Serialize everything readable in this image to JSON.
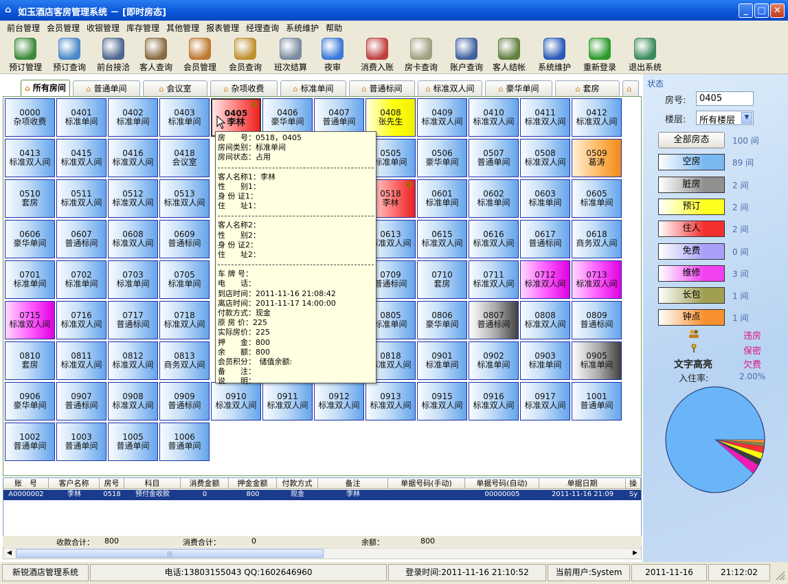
{
  "window": {
    "title": "如玉酒店客房管理系统 － [即时房态]",
    "icon": "app-house-icon"
  },
  "menu": [
    "前台管理",
    "会员管理",
    "收银管理",
    "库存管理",
    "其他管理",
    "报表管理",
    "经理查询",
    "系统维护",
    "帮助"
  ],
  "toolbar": [
    {
      "label": "预订管理",
      "icon": "globe-icon"
    },
    {
      "label": "预订查询",
      "icon": "magnifier-doc-icon"
    },
    {
      "label": "前台接洽",
      "icon": "receptionist-icon"
    },
    {
      "label": "客人查询",
      "icon": "person-search-icon"
    },
    {
      "label": "会员管理",
      "icon": "members-icon"
    },
    {
      "label": "会员查询",
      "icon": "member-key-icon"
    },
    {
      "label": "班次结算",
      "icon": "printer-icon"
    },
    {
      "label": "夜审",
      "icon": "clock-icon"
    },
    {
      "label": "消费入账",
      "icon": "house-entry-icon"
    },
    {
      "label": "房卡查询",
      "icon": "card-icon"
    },
    {
      "label": "账户查询",
      "icon": "monitor-icon"
    },
    {
      "label": "客人结帐",
      "icon": "checkout-chart-icon"
    },
    {
      "label": "系统维护",
      "icon": "tools-icon"
    },
    {
      "label": "重新登录",
      "icon": "refresh-icon"
    },
    {
      "label": "退出系统",
      "icon": "exit-door-icon"
    }
  ],
  "tabs": [
    "所有房间",
    "普通单间",
    "会议室",
    "杂项收费",
    "标准单间",
    "普通标间",
    "标准双人间",
    "豪华单间",
    "套房",
    ""
  ],
  "rooms": [
    {
      "n": "0000",
      "t": "杂项收费",
      "s": ""
    },
    {
      "n": "0401",
      "t": "标准单间",
      "s": ""
    },
    {
      "n": "0402",
      "t": "标准单间",
      "s": ""
    },
    {
      "n": "0403",
      "t": "标准单间",
      "s": ""
    },
    {
      "n": "0405",
      "t": "李林",
      "s": "red",
      "sel": true,
      "p": true
    },
    {
      "n": "0406",
      "t": "豪华单间",
      "s": ""
    },
    {
      "n": "0407",
      "t": "普通单间",
      "s": ""
    },
    {
      "n": "0408",
      "t": "张先生",
      "s": "yellow"
    },
    {
      "n": "0409",
      "t": "标准双人间",
      "s": ""
    },
    {
      "n": "0410",
      "t": "标准双人间",
      "s": ""
    },
    {
      "n": "0411",
      "t": "标准双人间",
      "s": ""
    },
    {
      "n": "0412",
      "t": "标准双人间",
      "s": ""
    },
    {
      "n": "0413",
      "t": "标准双人间",
      "s": ""
    },
    {
      "n": "0415",
      "t": "标准双人间",
      "s": ""
    },
    {
      "n": "0416",
      "t": "标准双人间",
      "s": ""
    },
    {
      "n": "0418",
      "t": "会议室",
      "s": ""
    },
    {
      "n": "",
      "t": "",
      "s": "",
      "hid": true
    },
    {
      "n": "",
      "t": "",
      "s": "",
      "hid": true
    },
    {
      "n": "",
      "t": "",
      "s": "",
      "hid": true
    },
    {
      "n": "0505",
      "t": "标准单间",
      "s": ""
    },
    {
      "n": "0506",
      "t": "豪华单间",
      "s": ""
    },
    {
      "n": "0507",
      "t": "普通单间",
      "s": ""
    },
    {
      "n": "0508",
      "t": "标准双人间",
      "s": ""
    },
    {
      "n": "0509",
      "t": "葛涛",
      "s": "orange"
    },
    {
      "n": "0510",
      "t": "套房",
      "s": ""
    },
    {
      "n": "0511",
      "t": "标准双人间",
      "s": ""
    },
    {
      "n": "0512",
      "t": "标准双人间",
      "s": ""
    },
    {
      "n": "0513",
      "t": "标准双人间",
      "s": ""
    },
    {
      "n": "",
      "t": "",
      "s": "",
      "hid": true
    },
    {
      "n": "",
      "t": "",
      "s": "",
      "hid": true
    },
    {
      "n": "",
      "t": "",
      "s": "",
      "hid": true
    },
    {
      "n": "0518",
      "t": "李林",
      "s": "red",
      "p": true
    },
    {
      "n": "0601",
      "t": "标准单间",
      "s": ""
    },
    {
      "n": "0602",
      "t": "标准单间",
      "s": ""
    },
    {
      "n": "0603",
      "t": "标准单间",
      "s": ""
    },
    {
      "n": "0605",
      "t": "标准单间",
      "s": ""
    },
    {
      "n": "0606",
      "t": "豪华单间",
      "s": ""
    },
    {
      "n": "0607",
      "t": "普通标间",
      "s": ""
    },
    {
      "n": "0608",
      "t": "标准双人间",
      "s": ""
    },
    {
      "n": "0609",
      "t": "普通标间",
      "s": ""
    },
    {
      "n": "",
      "t": "",
      "s": "",
      "hid": true
    },
    {
      "n": "",
      "t": "",
      "s": "",
      "hid": true
    },
    {
      "n": "",
      "t": "",
      "s": "",
      "hid": true
    },
    {
      "n": "0613",
      "t": "标准双人间",
      "s": ""
    },
    {
      "n": "0615",
      "t": "标准双人间",
      "s": ""
    },
    {
      "n": "0616",
      "t": "标准双人间",
      "s": ""
    },
    {
      "n": "0617",
      "t": "普通标间",
      "s": ""
    },
    {
      "n": "0618",
      "t": "商务双人间",
      "s": ""
    },
    {
      "n": "0701",
      "t": "标准单间",
      "s": ""
    },
    {
      "n": "0702",
      "t": "标准单间",
      "s": ""
    },
    {
      "n": "0703",
      "t": "标准单间",
      "s": ""
    },
    {
      "n": "0705",
      "t": "标准单间",
      "s": ""
    },
    {
      "n": "",
      "t": "",
      "s": "",
      "hid": true
    },
    {
      "n": "",
      "t": "",
      "s": "",
      "hid": true
    },
    {
      "n": "",
      "t": "",
      "s": "",
      "hid": true
    },
    {
      "n": "0709",
      "t": "普通标间",
      "s": ""
    },
    {
      "n": "0710",
      "t": "套房",
      "s": ""
    },
    {
      "n": "0711",
      "t": "标准双人间",
      "s": ""
    },
    {
      "n": "0712",
      "t": "标准双人间",
      "s": "magenta"
    },
    {
      "n": "0713",
      "t": "标准双人间",
      "s": "magenta"
    },
    {
      "n": "0715",
      "t": "标准双人间",
      "s": "magenta"
    },
    {
      "n": "0716",
      "t": "标准双人间",
      "s": ""
    },
    {
      "n": "0717",
      "t": "普通标间",
      "s": ""
    },
    {
      "n": "0718",
      "t": "标准双人间",
      "s": ""
    },
    {
      "n": "",
      "t": "",
      "s": "",
      "hid": true
    },
    {
      "n": "",
      "t": "",
      "s": "",
      "hid": true
    },
    {
      "n": "",
      "t": "",
      "s": "",
      "hid": true
    },
    {
      "n": "0805",
      "t": "标准单间",
      "s": ""
    },
    {
      "n": "0806",
      "t": "豪华单间",
      "s": ""
    },
    {
      "n": "0807",
      "t": "普通标间",
      "s": "gray"
    },
    {
      "n": "0808",
      "t": "标准双人间",
      "s": ""
    },
    {
      "n": "0809",
      "t": "普通标间",
      "s": ""
    },
    {
      "n": "0810",
      "t": "套房",
      "s": ""
    },
    {
      "n": "0811",
      "t": "标准双人间",
      "s": ""
    },
    {
      "n": "0812",
      "t": "标准双人间",
      "s": ""
    },
    {
      "n": "0813",
      "t": "商务双人间",
      "s": ""
    },
    {
      "n": "",
      "t": "",
      "s": "",
      "hid": true
    },
    {
      "n": "",
      "t": "",
      "s": "",
      "hid": true
    },
    {
      "n": "",
      "t": "",
      "s": "",
      "hid": true
    },
    {
      "n": "0818",
      "t": "标准双人间",
      "s": ""
    },
    {
      "n": "0901",
      "t": "标准单间",
      "s": ""
    },
    {
      "n": "0902",
      "t": "标准单间",
      "s": ""
    },
    {
      "n": "0903",
      "t": "标准单间",
      "s": ""
    },
    {
      "n": "0905",
      "t": "标准单间",
      "s": "gray"
    },
    {
      "n": "0906",
      "t": "豪华单间",
      "s": ""
    },
    {
      "n": "0907",
      "t": "普通标间",
      "s": ""
    },
    {
      "n": "0908",
      "t": "标准双人间",
      "s": ""
    },
    {
      "n": "0909",
      "t": "普通标间",
      "s": ""
    },
    {
      "n": "0910",
      "t": "标准双人间",
      "s": ""
    },
    {
      "n": "0911",
      "t": "标准双人间",
      "s": ""
    },
    {
      "n": "0912",
      "t": "标准双人间",
      "s": ""
    },
    {
      "n": "0913",
      "t": "标准双人间",
      "s": ""
    },
    {
      "n": "0915",
      "t": "标准双人间",
      "s": ""
    },
    {
      "n": "0916",
      "t": "标准双人间",
      "s": ""
    },
    {
      "n": "0917",
      "t": "标准双人间",
      "s": ""
    },
    {
      "n": "1001",
      "t": "普通单间",
      "s": ""
    },
    {
      "n": "1002",
      "t": "普通单间",
      "s": ""
    },
    {
      "n": "1003",
      "t": "普通单间",
      "s": ""
    },
    {
      "n": "1005",
      "t": "普通单间",
      "s": ""
    },
    {
      "n": "1006",
      "t": "普通单间",
      "s": ""
    }
  ],
  "tooltip": [
    "房　　号：0518，0405",
    "房间类别：标准单间",
    "房间状态：占用",
    "-",
    "客人名称1：李林",
    "性　　别1：",
    "身 份 证1：",
    "住　　址1：",
    "-",
    "客人名称2：",
    "性　　别2：",
    "身 份 证2：",
    "住　　址2：",
    "-",
    "车 牌 号：",
    "电　　话：",
    "到店时间：2011-11-16 21:08:42",
    "离店时间：2011-11-17 14:00:00",
    "付款方式：现金",
    "原 房 价：225",
    "实际房价：225",
    "押　　金：800",
    "余　　额：800",
    "会员积分：　储值余额:",
    "备　　注：",
    "说　　明："
  ],
  "right": {
    "status_label": "状态",
    "room_label": "房号:",
    "room_value": "0405",
    "floor_label": "楼层:",
    "floor_value": "所有楼层",
    "statuses": [
      {
        "label": "全部房态",
        "count": "100 间",
        "color": "#f2f2ee"
      },
      {
        "label": "空房",
        "count": "89 间",
        "color": "#7ab8f2"
      },
      {
        "label": "脏房",
        "count": "2 间",
        "color": "#909090"
      },
      {
        "label": "预订",
        "count": "2 间",
        "color": "#ffff20"
      },
      {
        "label": "住人",
        "count": "2 间",
        "color": "#f23030"
      },
      {
        "label": "免费",
        "count": "0 间",
        "color": "#a8a0f8"
      },
      {
        "label": "维修",
        "count": "3 间",
        "color": "#f040f0"
      },
      {
        "label": "长包",
        "count": "1 间",
        "color": "#a0a050"
      },
      {
        "label": "钟点",
        "count": "1 间",
        "color": "#f89030"
      }
    ],
    "legend": [
      "违房",
      "保密",
      "欠费"
    ],
    "highlight_label": "文字高亮",
    "occupancy_label": "入住率:",
    "occupancy_value": "2.00%",
    "pie": [
      {
        "name": "空房",
        "value": 89,
        "color": "#69b5f7"
      },
      {
        "name": "维修",
        "value": 3,
        "color": "#f41ab4"
      },
      {
        "name": "脏房",
        "value": 2,
        "color": "#3c3c3c"
      },
      {
        "name": "预订",
        "value": 2,
        "color": "#ffff00"
      },
      {
        "name": "住人",
        "value": 2,
        "color": "#ff3030"
      },
      {
        "name": "长包",
        "value": 1,
        "color": "#8a8a3a"
      },
      {
        "name": "钟点",
        "value": 1,
        "color": "#f89030"
      }
    ]
  },
  "ledger": {
    "columns": [
      "账　号",
      "客户名称",
      "房号",
      "科目",
      "消费金额",
      "押金金额",
      "付款方式",
      "备注",
      "单据号码(手动)",
      "单据号码(自动)",
      "单据日期",
      "操"
    ],
    "row": [
      "A0000002",
      "李林",
      "0518",
      "预付金收款",
      "0",
      "800",
      "现金",
      "李林",
      "",
      "00000005",
      "2011-11-16 21:09",
      "Sy"
    ]
  },
  "summary": {
    "income_label": "收款合计：",
    "income": "800",
    "expense_label": "消费合计：",
    "expense": "0",
    "balance_label": "余额：",
    "balance": "800"
  },
  "statusbar": {
    "app": "新锐酒店管理系统",
    "contact": "电话:13803155043 QQ:1602646960",
    "login": "登录时间:2011-11-16 21:10:52",
    "user": "当前用户:System",
    "date": "2011-11-16",
    "time": "21:12:02"
  },
  "colors": {
    "title_bar": "#0a55d8",
    "selected_row": "#1a3b8e",
    "grid_border": "#6d9d5f"
  }
}
